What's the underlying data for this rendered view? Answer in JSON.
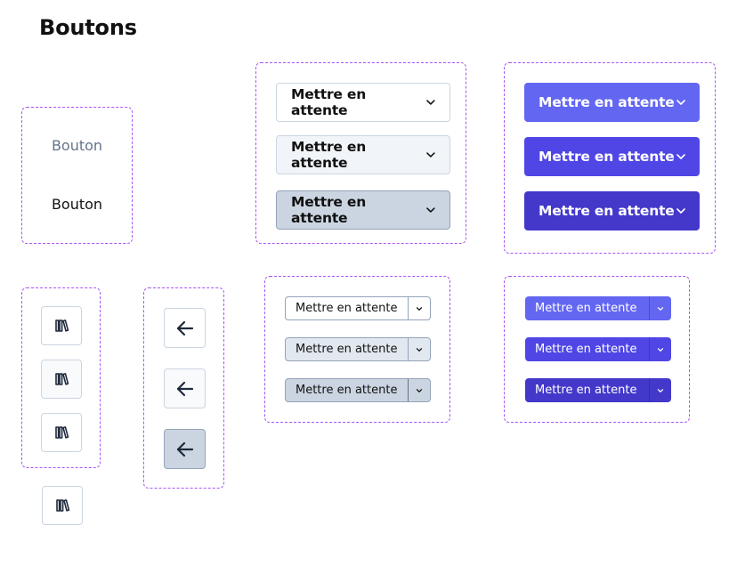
{
  "page": {
    "title": "Boutons"
  },
  "text_buttons": [
    "Bouton",
    "Bouton"
  ],
  "large_dropdown": {
    "label": "Mettre en attente"
  },
  "split_button": {
    "label": "Mettre en attente"
  },
  "icons": {
    "library": "library-icon",
    "back": "arrow-left-icon",
    "dropdown": "chevron-down-icon"
  },
  "colors": {
    "frame": "#a855f7",
    "primary": "#6366f1",
    "primary_hover": "#4f46e5",
    "primary_active": "#4338ca",
    "secondary_hover": "#f1f5f9",
    "secondary_active": "#cbd5e1",
    "muted_text": "#64748b"
  }
}
